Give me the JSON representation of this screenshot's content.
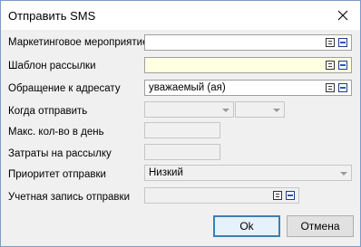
{
  "window": {
    "title": "Отправить SMS"
  },
  "form": {
    "marketing_event": {
      "label": "Маркетинговое мероприятие",
      "value": ""
    },
    "mailing_template": {
      "label": "Шаблон рассылки",
      "value": ""
    },
    "salutation": {
      "label": "Обращение к адресату",
      "value": "уважаемый (ая)"
    },
    "send_when": {
      "label": "Когда отправить",
      "date": "",
      "time": ""
    },
    "max_per_day": {
      "label": "Макс. кол-во в день",
      "value": ""
    },
    "mailing_cost": {
      "label": "Затраты на рассылку",
      "value": ""
    },
    "send_priority": {
      "label": "Приоритет отправки",
      "value": "Низкий"
    },
    "sending_account": {
      "label": "Учетная запись отправки",
      "value": ""
    }
  },
  "buttons": {
    "ok": "Ok",
    "cancel": "Отмена"
  },
  "colors": {
    "required_field_bg": "#ffffe1",
    "default_button_border": "#3c7fb1"
  }
}
